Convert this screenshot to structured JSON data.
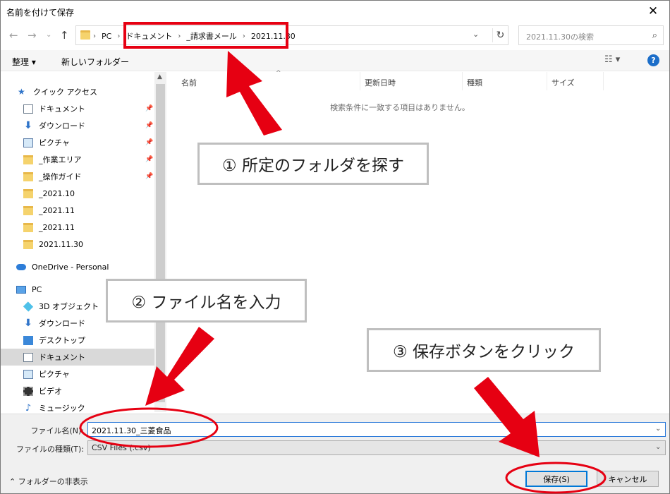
{
  "window": {
    "title": "名前を付けて保存",
    "close_glyph": "✕"
  },
  "addressbar": {
    "breadcrumbs": [
      "PC",
      "ドキュメント",
      "_請求書メール",
      "2021.11.30"
    ],
    "search_placeholder": "2021.11.30の検索"
  },
  "toolbar": {
    "organize": "整理 ▾",
    "new_folder": "新しいフォルダー",
    "help": "?"
  },
  "navpane": {
    "quick_access": "クイック アクセス",
    "items": [
      {
        "label": "ドキュメント",
        "icon": "document-icon",
        "pinned": true
      },
      {
        "label": "ダウンロード",
        "icon": "download-icon",
        "pinned": true
      },
      {
        "label": "ピクチャ",
        "icon": "pictures-icon",
        "pinned": true
      },
      {
        "label": "_作業エリア",
        "icon": "folder-icon",
        "pinned": true
      },
      {
        "label": "_操作ガイド",
        "icon": "folder-icon",
        "pinned": true
      },
      {
        "label": "_2021.10",
        "icon": "folder-icon",
        "pinned": false
      },
      {
        "label": "_2021.11",
        "icon": "folder-icon",
        "pinned": false
      },
      {
        "label": "_2021.11",
        "icon": "folder-icon",
        "pinned": false
      },
      {
        "label": "2021.11.30",
        "icon": "folder-icon",
        "pinned": false
      }
    ],
    "onedrive": "OneDrive - Personal",
    "pc": "PC",
    "pc_items": [
      {
        "label": "3D オブジェクト",
        "icon": "3d-objects-icon"
      },
      {
        "label": "ダウンロード",
        "icon": "download-icon"
      },
      {
        "label": "デスクトップ",
        "icon": "desktop-icon"
      },
      {
        "label": "ドキュメント",
        "icon": "document-icon"
      },
      {
        "label": "ピクチャ",
        "icon": "pictures-icon"
      },
      {
        "label": "ビデオ",
        "icon": "videos-icon"
      },
      {
        "label": "ミュージック",
        "icon": "music-icon"
      }
    ]
  },
  "filelist": {
    "columns": [
      "名前",
      "更新日時",
      "種類",
      "サイズ"
    ],
    "empty_message": "検索条件に一致する項目はありません。"
  },
  "bottom": {
    "filename_label": "ファイル名(N):",
    "filename_value": "2021.11.30_三菱食品",
    "filetype_label": "ファイルの種類(T):",
    "filetype_value": "CSV Files (.csv)",
    "hide_folders": "フォルダーの非表示",
    "save": "保存(S)",
    "cancel": "キャンセル"
  },
  "annotations": {
    "step1": "① 所定のフォルダを探す",
    "step2": "② ファイル名を入力",
    "step3": "③ 保存ボタンをクリック",
    "accent_color": "#e60012"
  }
}
